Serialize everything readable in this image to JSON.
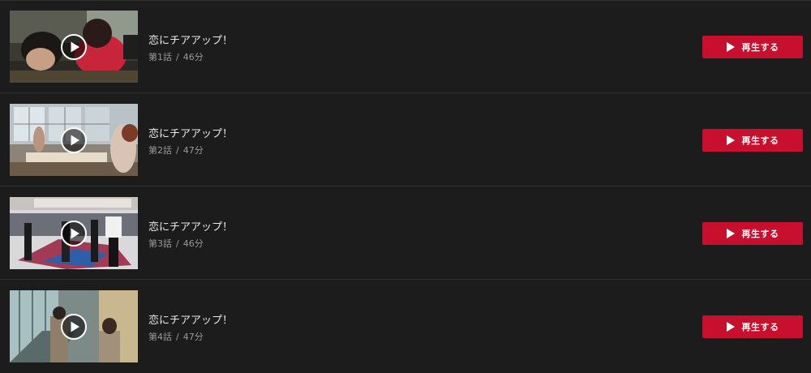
{
  "colors": {
    "background": "#1c1c1c",
    "divider": "#2f2f2f",
    "accent": "#c8102e",
    "title_text": "#e8e8e8",
    "meta_text": "#9a9a9a"
  },
  "icons": {
    "thumbnail_overlay": "play-circle-icon",
    "button": "play-triangle-icon"
  },
  "episodes": [
    {
      "title": "恋にチアアップ！",
      "number": "第1話",
      "separator": "/",
      "duration": "46分",
      "play_label": "再生する"
    },
    {
      "title": "恋にチアアップ！",
      "number": "第2話",
      "separator": "/",
      "duration": "47分",
      "play_label": "再生する"
    },
    {
      "title": "恋にチアアップ！",
      "number": "第3話",
      "separator": "/",
      "duration": "46分",
      "play_label": "再生する"
    },
    {
      "title": "恋にチアアップ！",
      "number": "第4話",
      "separator": "/",
      "duration": "47分",
      "play_label": "再生する"
    }
  ]
}
